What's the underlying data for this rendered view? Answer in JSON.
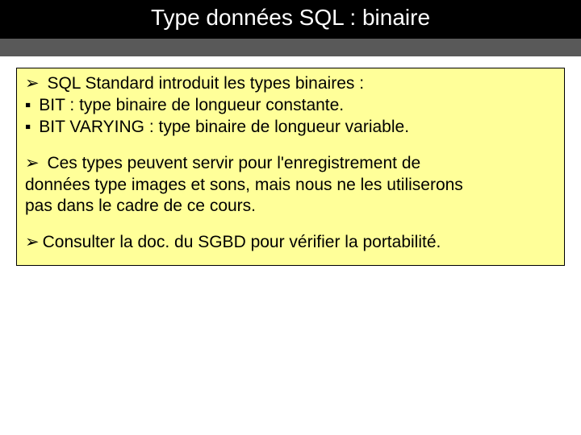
{
  "header": {
    "title": "Type données SQL : binaire"
  },
  "content": {
    "p1": {
      "l1_bullet": "➢",
      "l1_text": " SQL Standard introduit les types binaires :",
      "l2_bullet": "▪",
      "l2_text": " BIT : type binaire de longueur constante.",
      "l3_bullet": "▪",
      "l3_text": " BIT VARYING : type binaire de longueur variable."
    },
    "p2": {
      "l1_bullet": "➢",
      "l1_text": " Ces types peuvent servir pour l'enregistrement de",
      "l2_text": "données type images et sons, mais nous ne les utiliserons",
      "l3_text": "pas dans le cadre de ce cours."
    },
    "p3": {
      "l1_bullet": "➢",
      "l1_text": "Consulter la doc. du SGBD pour vérifier la portabilité."
    }
  }
}
